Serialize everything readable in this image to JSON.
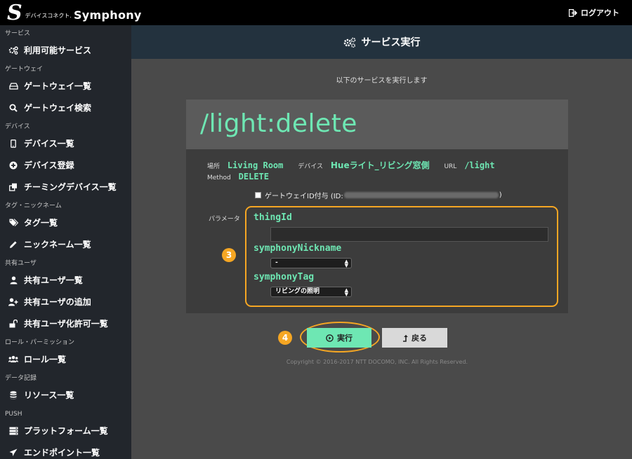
{
  "header": {
    "logo_mark": "S",
    "logo_sub": "デバイスコネクト.",
    "logo_main": "Symphony",
    "logout_label": "ログアウト"
  },
  "sidebar": {
    "sections": [
      {
        "title": "サービス",
        "items": [
          {
            "label": "利用可能サービス",
            "icon": "gears-icon"
          }
        ]
      },
      {
        "title": "ゲートウェイ",
        "items": [
          {
            "label": "ゲートウェイ一覧",
            "icon": "hdd-icon"
          },
          {
            "label": "ゲートウェイ検索",
            "icon": "search-icon"
          }
        ]
      },
      {
        "title": "デバイス",
        "items": [
          {
            "label": "デバイス一覧",
            "icon": "mobile-icon"
          },
          {
            "label": "デバイス登録",
            "icon": "plus-circle-icon"
          },
          {
            "label": "チーミングデバイス一覧",
            "icon": "clone-icon"
          }
        ]
      },
      {
        "title": "タグ・ニックネーム",
        "items": [
          {
            "label": "タグ一覧",
            "icon": "tags-icon"
          },
          {
            "label": "ニックネーム一覧",
            "icon": "pencil-icon"
          }
        ]
      },
      {
        "title": "共有ユーザ",
        "items": [
          {
            "label": "共有ユーザ一覧",
            "icon": "user-icon"
          },
          {
            "label": "共有ユーザの追加",
            "icon": "user-plus-icon"
          },
          {
            "label": "共有ユーザ化許可一覧",
            "icon": "unlock-icon"
          }
        ]
      },
      {
        "title": "ロール・パーミッション",
        "items": [
          {
            "label": "ロール一覧",
            "icon": "users-icon"
          }
        ]
      },
      {
        "title": "データ記録",
        "items": [
          {
            "label": "リソース一覧",
            "icon": "database-icon"
          }
        ]
      },
      {
        "title": "PUSH",
        "items": [
          {
            "label": "プラットフォーム一覧",
            "icon": "server-icon"
          },
          {
            "label": "エンドポイント一覧",
            "icon": "send-icon"
          }
        ]
      }
    ]
  },
  "main": {
    "title": "サービス実行",
    "intro": "以下のサービスを実行します",
    "service_path": "/light:delete",
    "meta": {
      "place_label": "場所",
      "place_value": "Living Room",
      "device_label": "デバイス",
      "device_value": "Hueライト_リビング窓側",
      "url_label": "URL",
      "url_value": "/light",
      "method_label": "Method",
      "method_value": "DELETE"
    },
    "gateway_checkbox_label": "ゲートウェイID付与 (ID:",
    "gateway_checkbox_suffix": ")",
    "params_label": "パラメータ",
    "params": {
      "thing_id_label": "thingId",
      "thing_id_value": "",
      "nickname_label": "symphonyNickname",
      "nickname_value": "-",
      "tag_label": "symphonyTag",
      "tag_value": "リビングの照明"
    },
    "badges": {
      "params": "3",
      "exec": "4"
    },
    "execute_label": "実行",
    "back_label": "戻る",
    "copyright": "Copyright © 2016-2017 NTT DOCOMO, INC. All Rights Reserved."
  },
  "colors": {
    "accent": "#6ee7b3",
    "highlight": "#f5a623",
    "sidebar": "#22262c",
    "header": "#23323e"
  }
}
